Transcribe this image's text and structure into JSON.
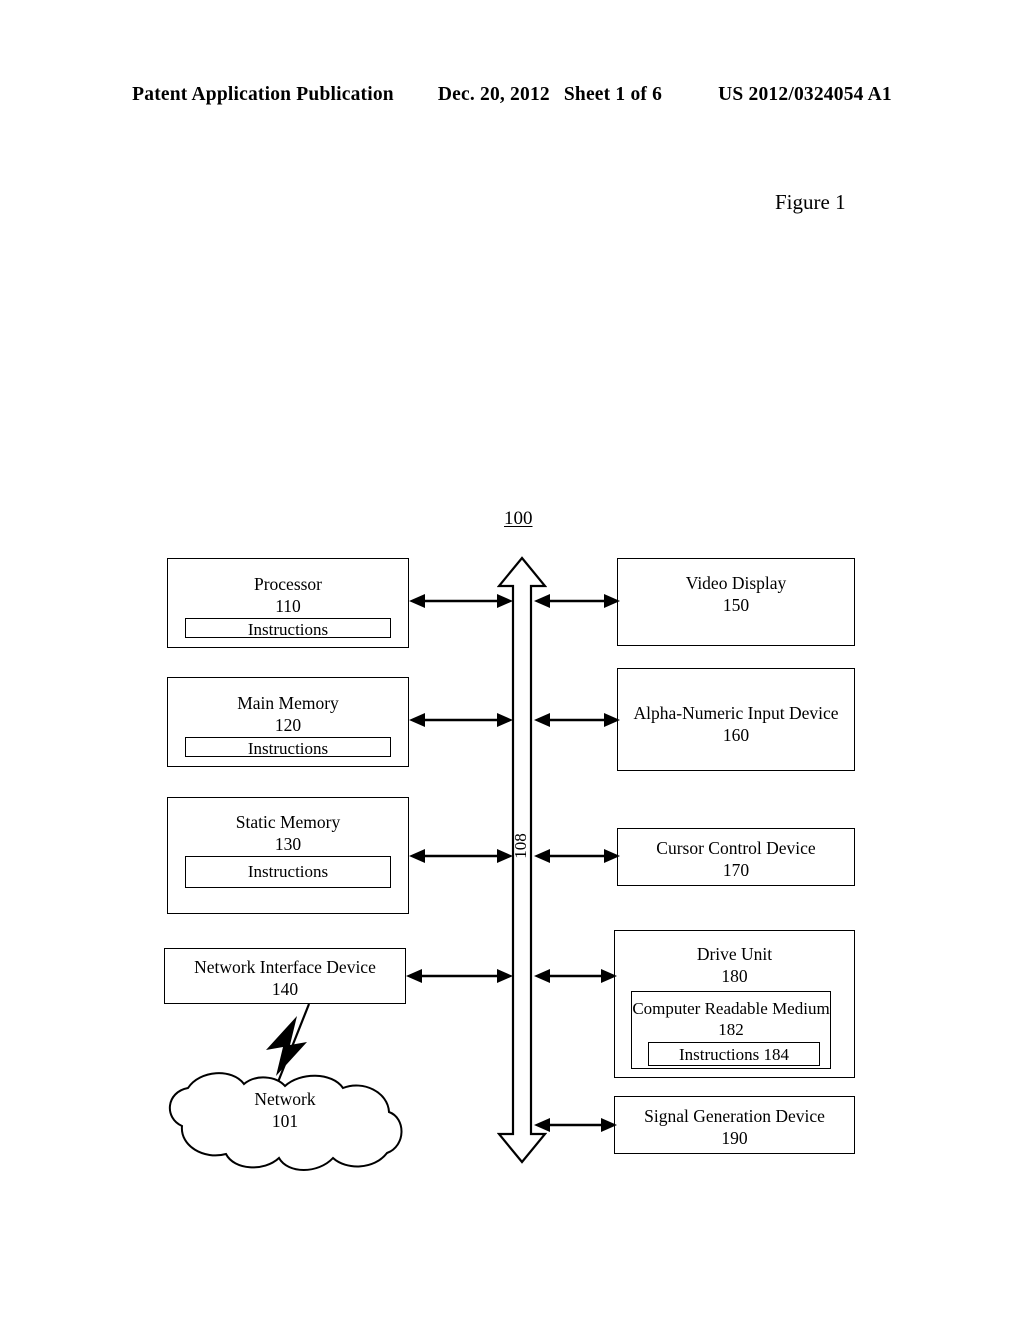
{
  "header": {
    "publication": "Patent Application Publication",
    "date": "Dec. 20, 2012",
    "sheet": "Sheet 1 of 6",
    "doc_number": "US 2012/0324054 A1"
  },
  "figure": {
    "caption": "Figure 1",
    "system_label": "100",
    "bus_label": "108"
  },
  "left_blocks": [
    {
      "title": "Processor",
      "number": "110",
      "inner": {
        "label": "Instructions"
      }
    },
    {
      "title": "Main Memory",
      "number": "120",
      "inner": {
        "label": "Instructions"
      }
    },
    {
      "title": "Static Memory",
      "number": "130",
      "inner": {
        "label": "Instructions"
      }
    },
    {
      "title": "Network Interface Device",
      "number": "140"
    }
  ],
  "right_blocks": [
    {
      "title": "Video Display",
      "number": "150"
    },
    {
      "title": "Alpha-Numeric Input Device",
      "number": "160"
    },
    {
      "title": "Cursor Control Device",
      "number": "170"
    },
    {
      "title": "Drive Unit",
      "number": "180",
      "medium": {
        "title": "Computer Readable Medium",
        "number": "182",
        "instructions": "Instructions 184"
      }
    },
    {
      "title": "Signal Generation Device",
      "number": "190"
    }
  ],
  "network": {
    "title": "Network",
    "number": "101"
  },
  "colors": {
    "ink": "#000000",
    "paper": "#ffffff"
  },
  "icons": {
    "bus": "double-headed-bus-arrow",
    "wireless": "lightning-bolt-icon",
    "cloud": "cloud-shape-icon"
  }
}
